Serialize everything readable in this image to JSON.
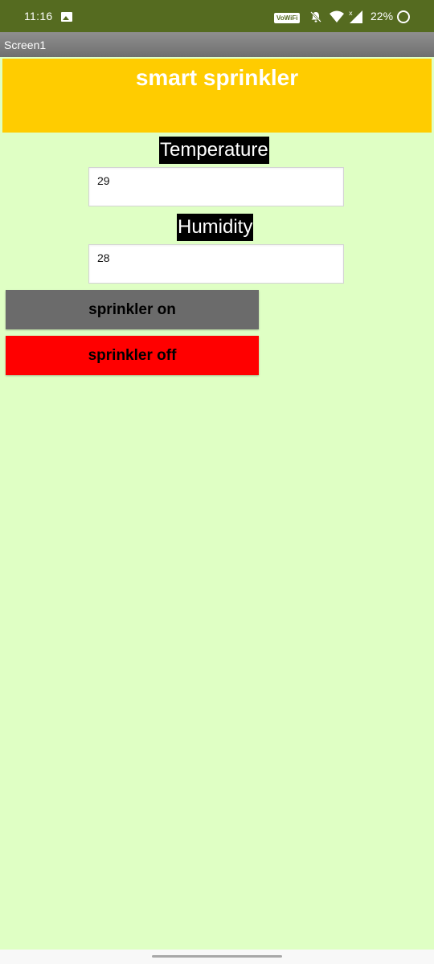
{
  "status_bar": {
    "time": "11:16",
    "wifi_badge": "VoWiFi",
    "battery_percent": "22%",
    "icons": [
      "gallery-icon",
      "bell-off-icon",
      "wifi-icon",
      "signal-icon",
      "battery-ring-icon"
    ]
  },
  "title_bar": {
    "title": "Screen1"
  },
  "banner": {
    "title": "smart sprinkler"
  },
  "temperature": {
    "label": "Temperature",
    "value": "29"
  },
  "humidity": {
    "label": "Humidity",
    "value": "28"
  },
  "buttons": {
    "on_label": "sprinkler on",
    "off_label": "sprinkler off"
  },
  "colors": {
    "status_bar": "#556b20",
    "background": "#dfffc4",
    "banner": "#ffcc00",
    "button_on": "#6b6b6b",
    "button_off": "#ff0000"
  }
}
